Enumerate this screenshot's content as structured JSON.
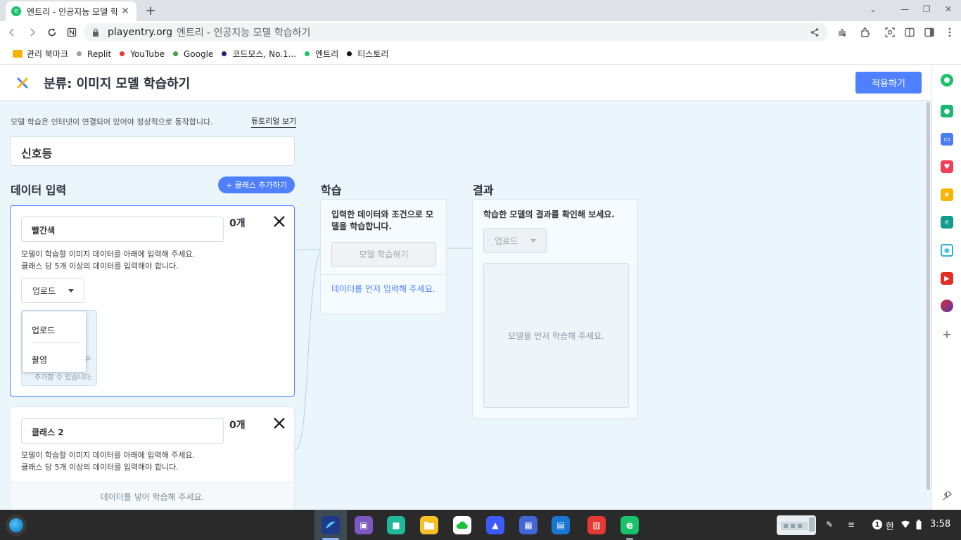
{
  "browser": {
    "tab_title": "엔트리 - 인공지능 모델 학습하",
    "favicon_text": "e",
    "url_host": "playentry.org",
    "url_path": "엔트리 - 인공지능 모델 학습하기",
    "bookmarks": [
      {
        "label": "관리 북마크",
        "icon": "folder-icon",
        "color": "#f4b400"
      },
      {
        "label": "Replit",
        "icon": "dot-icon",
        "color": "#9e9e9e"
      },
      {
        "label": "YouTube",
        "icon": "dot-icon",
        "color": "#e53935"
      },
      {
        "label": "Google",
        "icon": "dot-icon",
        "color": "#43a047"
      },
      {
        "label": "코드모스, No.1...",
        "icon": "dot-icon",
        "color": "#1a237e"
      },
      {
        "label": "엔트리",
        "icon": "dot-icon",
        "color": "#18c269"
      },
      {
        "label": "티스토리",
        "icon": "dot-icon",
        "color": "#111111"
      }
    ]
  },
  "header": {
    "title": "분류: 이미지 모델 학습하기",
    "apply_label": "적용하기"
  },
  "notice": {
    "text": "모델 학습은 인터넷이 연결되어 있어야 정상적으로 동작합니다.",
    "tutorial_label": "튜토리얼 보기"
  },
  "model_name": "신호등",
  "data_section": {
    "title": "데이터 입력",
    "add_class_label": "+ 클래스 추가하기",
    "classes": [
      {
        "name": "빨간색",
        "count": "0개",
        "desc_line1": "모델이 학습할 이미지 데이터를 아래에 입력해 주세요.",
        "desc_line2": "클래스 당 5개 이상의 데이터를 입력해야 합니다.",
        "upload_label": "업로드",
        "drop_fragment1": "p.",
        "drop_fragment2": "추가할 수 있습니다.",
        "menu": [
          "업로드",
          "촬영"
        ]
      },
      {
        "name": "클래스 2",
        "count": "0개",
        "desc_line1": "모델이 학습할 이미지 데이터를 아래에 입력해 주세요.",
        "desc_line2": "클래스 당 5개 이상의 데이터를 입력해야 합니다.",
        "footer": "데이터를 넣어 학습해 주세요."
      }
    ]
  },
  "learn": {
    "title": "학습",
    "text": "입력한 데이터와 조건으로 모델을 학습합니다.",
    "button_label": "모델 학습하기",
    "hint": "데이터를 먼저 입력해 주세요."
  },
  "result": {
    "title": "결과",
    "text": "학습한 모델의 결과를 확인해 보세요.",
    "upload_label": "업로드",
    "placeholder": "모델을 먼저 학습해 주세요."
  },
  "taskbar": {
    "ime": "한",
    "notification_count": "1",
    "time": "3:58"
  },
  "colors": {
    "accent": "#4f80ff",
    "page_bg": "#eaf5fc"
  }
}
